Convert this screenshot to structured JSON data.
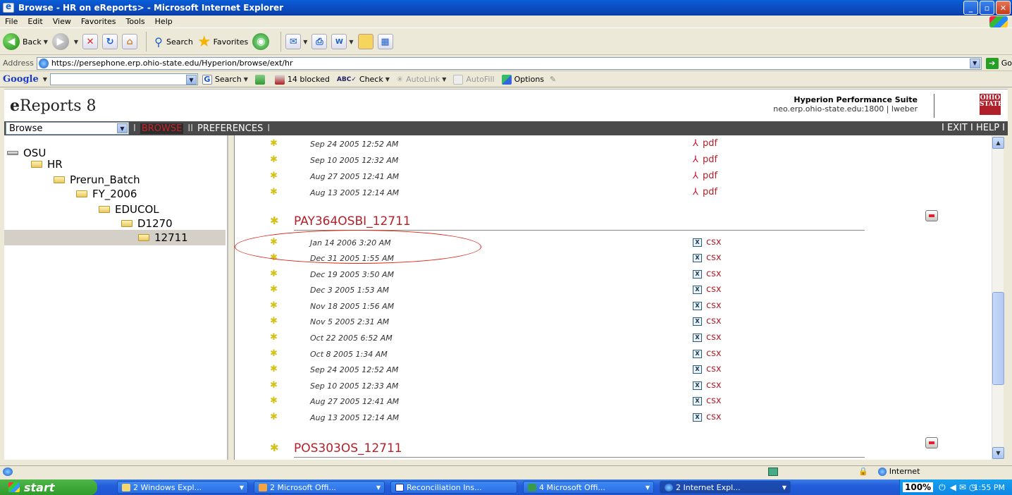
{
  "window": {
    "title": "Browse - HR on eReports> - Microsoft Internet Explorer",
    "buttons": [
      "_",
      "▫",
      "✕"
    ]
  },
  "menu": [
    "File",
    "Edit",
    "View",
    "Favorites",
    "Tools",
    "Help"
  ],
  "toolbar": {
    "back": "Back",
    "search": "Search",
    "favorites": "Favorites"
  },
  "address": {
    "label": "Address",
    "url": "https://persephone.erp.ohio-state.edu/Hyperion/browse/ext/hr",
    "go": "Go"
  },
  "google_bar": {
    "logo": "Google",
    "search": "Search",
    "blocked": "14 blocked",
    "check": "Check",
    "autolink": "AutoLink",
    "autofill": "AutoFill",
    "options": "Options"
  },
  "app": {
    "title_bold": "e",
    "title_rest": "Reports 8",
    "suite": "Hyperion Performance Suite",
    "server": "neo.erp.ohio-state.edu:1800 | lweber",
    "logo": "OHIO STATE"
  },
  "nav": {
    "select_value": "Browse",
    "sep1": "I",
    "browse": "BROWSE",
    "sep2": "II",
    "preferences": "PREFERENCES",
    "sep3": "I",
    "exit_help": "I EXIT I HELP I"
  },
  "tree": [
    {
      "label": "OSU"
    },
    {
      "label": "HR"
    },
    {
      "label": "Prerun_Batch"
    },
    {
      "label": "FY_2006"
    },
    {
      "label": "EDUCOL"
    },
    {
      "label": "D1270"
    },
    {
      "label": "12711"
    }
  ],
  "top_rows": [
    {
      "date": "Sep 24 2005  12:52 AM",
      "format": "pdf"
    },
    {
      "date": "Sep 10 2005  12:32 AM",
      "format": "pdf"
    },
    {
      "date": "Aug 27 2005  12:41 AM",
      "format": "pdf"
    },
    {
      "date": "Aug 13 2005  12:14 AM",
      "format": "pdf"
    }
  ],
  "section1": {
    "name": "PAY364OSBI_12711",
    "rows": [
      {
        "date": "Jan 14 2006  3:20 AM",
        "format": "csx"
      },
      {
        "date": "Dec 31 2005  1:55 AM",
        "format": "csx"
      },
      {
        "date": "Dec 19 2005  3:50 AM",
        "format": "csx"
      },
      {
        "date": "Dec 3 2005  1:53 AM",
        "format": "csx"
      },
      {
        "date": "Nov 18 2005  1:56 AM",
        "format": "csx"
      },
      {
        "date": "Nov 5 2005  2:31 AM",
        "format": "csx"
      },
      {
        "date": "Oct 22 2005  6:52 AM",
        "format": "csx"
      },
      {
        "date": "Oct 8 2005  1:34 AM",
        "format": "csx"
      },
      {
        "date": "Sep 24 2005  12:52 AM",
        "format": "csx"
      },
      {
        "date": "Sep 10 2005  12:33 AM",
        "format": "csx"
      },
      {
        "date": "Aug 27 2005  12:41 AM",
        "format": "csx"
      },
      {
        "date": "Aug 13 2005  12:14 AM",
        "format": "csx"
      }
    ]
  },
  "section2": {
    "name": "POS303OS_12711"
  },
  "status": {
    "zone": "Internet"
  },
  "taskbar": {
    "start": "start",
    "tasks": [
      "2 Windows Expl...",
      "2 Microsoft Offi...",
      "Reconciliation Ins...",
      "4 Microsoft Offi...",
      "2 Internet Expl..."
    ],
    "zoom": "100%",
    "time": "1:55 PM"
  }
}
